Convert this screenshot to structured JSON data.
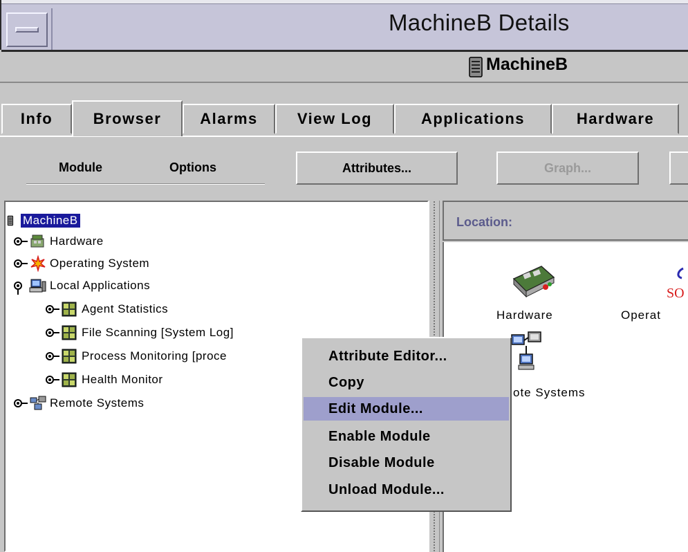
{
  "window": {
    "title": "MachineB Details"
  },
  "host": {
    "name": "MachineB",
    "icon": "server-icon"
  },
  "tabs": [
    {
      "label": "Info",
      "active": false
    },
    {
      "label": "Browser",
      "active": true
    },
    {
      "label": "Alarms",
      "active": false
    },
    {
      "label": "View Log",
      "active": false
    },
    {
      "label": "Applications",
      "active": false
    },
    {
      "label": "Hardware",
      "active": false
    }
  ],
  "toolbar": {
    "menus": [
      "Module",
      "Options"
    ],
    "buttons": [
      {
        "label": "Attributes...",
        "enabled": true
      },
      {
        "label": "Graph...",
        "enabled": false
      }
    ]
  },
  "tree": {
    "items": [
      {
        "label": "MachineB",
        "icon": "server-icon",
        "selected": true
      },
      {
        "label": "Hardware",
        "icon": "hardware-icon",
        "expanded": false
      },
      {
        "label": "Operating System",
        "icon": "operating-system-icon",
        "expanded": false
      },
      {
        "label": "Local Applications",
        "icon": "local-applications-icon",
        "expanded": true
      },
      {
        "label": "Agent Statistics",
        "icon": "module-icon",
        "expanded": false
      },
      {
        "label": "File Scanning [System Log]",
        "icon": "module-icon",
        "expanded": false
      },
      {
        "label": "Process Monitoring [proce",
        "icon": "module-icon",
        "expanded": false
      },
      {
        "label": "Health Monitor",
        "icon": "module-icon",
        "expanded": false
      },
      {
        "label": "Remote Systems",
        "icon": "remote-systems-icon",
        "expanded": false
      }
    ]
  },
  "location": {
    "label": "Location:"
  },
  "icon_view": {
    "items": [
      {
        "label": "Hardware",
        "icon": "hardware-icon"
      },
      {
        "label": "Operat",
        "icon": "operating-system-icon"
      },
      {
        "label": "ote Systems",
        "icon": "remote-systems-icon"
      }
    ]
  },
  "context_menu": {
    "items": [
      {
        "label": "Attribute Editor...",
        "highlighted": false
      },
      {
        "label": "Copy",
        "highlighted": false
      },
      {
        "label": "Edit Module...",
        "highlighted": true
      },
      {
        "label": "Enable Module",
        "highlighted": false
      },
      {
        "label": "Disable Module",
        "highlighted": false
      },
      {
        "label": "Unload Module...",
        "highlighted": false
      }
    ]
  },
  "colors": {
    "selection": "#1a1a9c",
    "menu_highlight": "#9e9fcc",
    "title_bar": "#c6c5d9",
    "location_label": "#5b5b8c"
  }
}
